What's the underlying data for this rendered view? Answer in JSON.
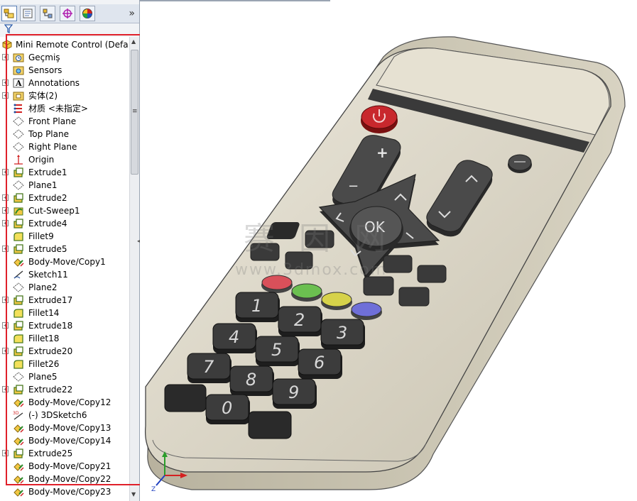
{
  "featureManager": {
    "filter_icon": "funnel-icon",
    "tabs": [
      {
        "name": "tab-feature-manager",
        "icon": "feature-tree-icon"
      },
      {
        "name": "tab-property-manager",
        "icon": "property-icon"
      },
      {
        "name": "tab-configuration-manager",
        "icon": "configuration-icon"
      },
      {
        "name": "tab-dimxpert-manager",
        "icon": "crosshair-icon"
      },
      {
        "name": "tab-display-manager",
        "icon": "color-wheel-icon"
      }
    ],
    "expand_label": "»",
    "root": {
      "label": "Mini Remote Control  (Defa",
      "icon": "part-icon"
    },
    "items": [
      {
        "label": "Geçmiş",
        "icon": "history-folder-icon",
        "expand": "+"
      },
      {
        "label": "Sensors",
        "icon": "sensor-folder-icon",
        "expand": ""
      },
      {
        "label": "Annotations",
        "icon": "annotation-icon",
        "expand": "+"
      },
      {
        "label": "实体(2)",
        "icon": "solid-bodies-folder-icon",
        "expand": "+"
      },
      {
        "label": "材质 <未指定>",
        "icon": "material-icon",
        "expand": ""
      },
      {
        "label": "Front Plane",
        "icon": "plane-icon",
        "expand": ""
      },
      {
        "label": "Top Plane",
        "icon": "plane-icon",
        "expand": ""
      },
      {
        "label": "Right Plane",
        "icon": "plane-icon",
        "expand": ""
      },
      {
        "label": "Origin",
        "icon": "origin-icon",
        "expand": ""
      },
      {
        "label": "Extrude1",
        "icon": "extrude-icon",
        "expand": "+"
      },
      {
        "label": "Plane1",
        "icon": "plane-icon",
        "expand": ""
      },
      {
        "label": "Extrude2",
        "icon": "extrude-icon",
        "expand": "+"
      },
      {
        "label": "Cut-Sweep1",
        "icon": "cut-sweep-icon",
        "expand": "+"
      },
      {
        "label": "Extrude4",
        "icon": "extrude-icon",
        "expand": "+"
      },
      {
        "label": "Fillet9",
        "icon": "fillet-icon",
        "expand": ""
      },
      {
        "label": "Extrude5",
        "icon": "extrude-icon",
        "expand": "+"
      },
      {
        "label": "Body-Move/Copy1",
        "icon": "body-move-icon",
        "expand": ""
      },
      {
        "label": "Sketch11",
        "icon": "sketch-icon",
        "expand": ""
      },
      {
        "label": "Plane2",
        "icon": "plane-icon",
        "expand": ""
      },
      {
        "label": "Extrude17",
        "icon": "extrude-icon",
        "expand": "+"
      },
      {
        "label": "Fillet14",
        "icon": "fillet-icon",
        "expand": ""
      },
      {
        "label": "Extrude18",
        "icon": "extrude-icon",
        "expand": "+"
      },
      {
        "label": "Fillet18",
        "icon": "fillet-icon",
        "expand": ""
      },
      {
        "label": "Extrude20",
        "icon": "extrude-icon",
        "expand": "+"
      },
      {
        "label": "Fillet26",
        "icon": "fillet-icon",
        "expand": ""
      },
      {
        "label": "Plane5",
        "icon": "plane-icon",
        "expand": ""
      },
      {
        "label": "Extrude22",
        "icon": "extrude-icon",
        "expand": "+"
      },
      {
        "label": "Body-Move/Copy12",
        "icon": "body-move-icon",
        "expand": ""
      },
      {
        "label": "(-) 3DSketch6",
        "icon": "3d-sketch-icon",
        "expand": ""
      },
      {
        "label": "Body-Move/Copy13",
        "icon": "body-move-icon",
        "expand": ""
      },
      {
        "label": "Body-Move/Copy14",
        "icon": "body-move-icon",
        "expand": ""
      },
      {
        "label": "Extrude25",
        "icon": "extrude-icon",
        "expand": "+"
      },
      {
        "label": "Body-Move/Copy21",
        "icon": "body-move-icon",
        "expand": ""
      },
      {
        "label": "Body-Move/Copy22",
        "icon": "body-move-icon",
        "expand": ""
      },
      {
        "label": "Body-Move/Copy23",
        "icon": "body-move-icon",
        "expand": ""
      }
    ]
  },
  "model": {
    "keys": [
      "1",
      "2",
      "3",
      "4",
      "5",
      "6",
      "7",
      "8",
      "9",
      "0"
    ],
    "ok_label": "OK",
    "plus_label": "+",
    "minus_label": "−",
    "body_color": "#d9d4c4",
    "button_color": "#3a3a3a",
    "power_color": "#c8282d",
    "color_keys": [
      "#d9505a",
      "#6bbf50",
      "#d6d24a",
      "#6f6fd8"
    ]
  },
  "watermark": {
    "line1": "赛 因 网",
    "line2": "www.3dmox.com"
  },
  "triad": {
    "x_color": "#d42020",
    "y_color": "#2a9d2a",
    "z_color": "#2040c0",
    "z_label": "Z"
  },
  "highlight_color": "#e0202a"
}
